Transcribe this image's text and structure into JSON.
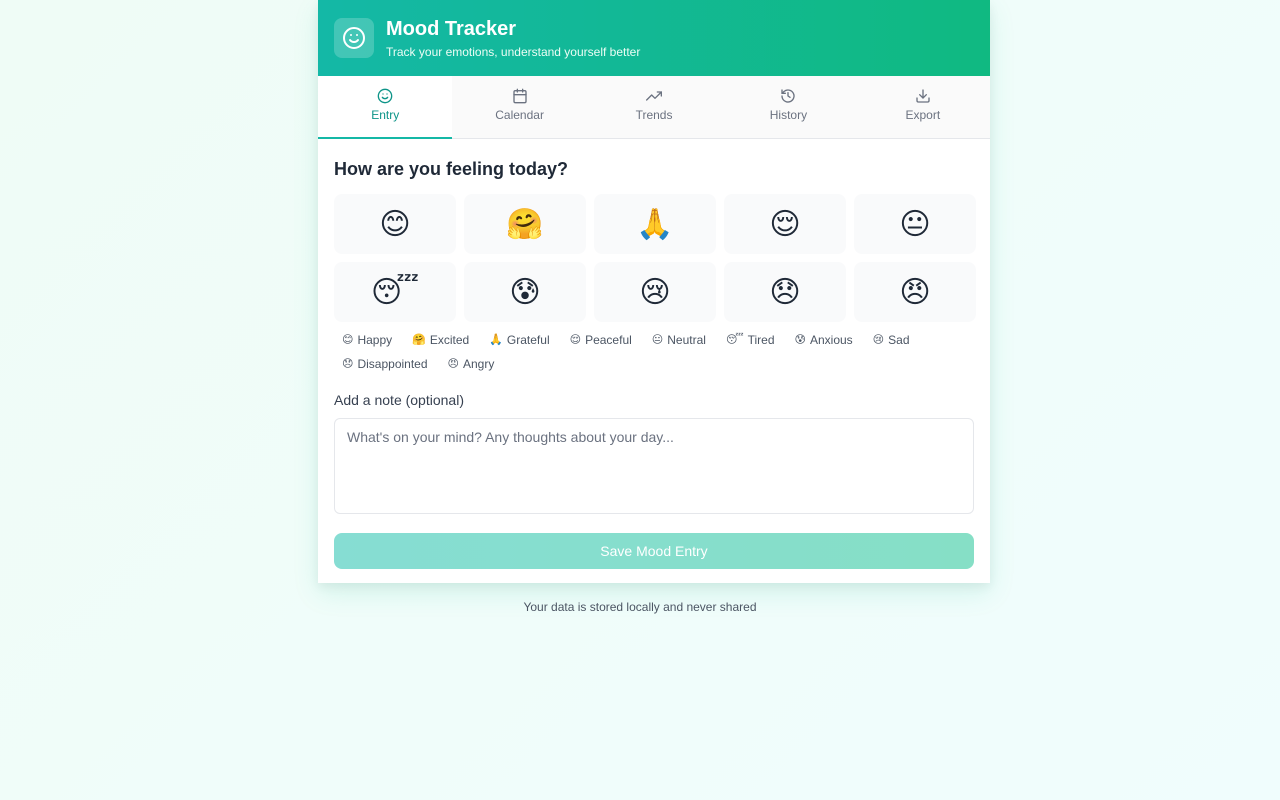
{
  "app": {
    "title": "Mood Tracker",
    "subtitle": "Track your emotions, understand yourself better",
    "logo_icon": "smile-icon"
  },
  "tabs": [
    {
      "label": "Entry",
      "icon": "smile-icon",
      "active": true
    },
    {
      "label": "Calendar",
      "icon": "calendar-icon",
      "active": false
    },
    {
      "label": "Trends",
      "icon": "trending-up-icon",
      "active": false
    },
    {
      "label": "History",
      "icon": "history-icon",
      "active": false
    },
    {
      "label": "Export",
      "icon": "download-icon",
      "active": false
    }
  ],
  "entry": {
    "question": "How are you feeling today?",
    "moods": [
      {
        "emoji": "😊",
        "label": "Happy"
      },
      {
        "emoji": "🤗",
        "label": "Excited"
      },
      {
        "emoji": "🙏",
        "label": "Grateful"
      },
      {
        "emoji": "😌",
        "label": "Peaceful"
      },
      {
        "emoji": "😐",
        "label": "Neutral"
      },
      {
        "emoji": "😴",
        "label": "Tired"
      },
      {
        "emoji": "😰",
        "label": "Anxious"
      },
      {
        "emoji": "😢",
        "label": "Sad"
      },
      {
        "emoji": "😞",
        "label": "Disappointed"
      },
      {
        "emoji": "😠",
        "label": "Angry"
      }
    ],
    "note_label": "Add a note (optional)",
    "note_placeholder": "What's on your mind? Any thoughts about your day...",
    "note_value": "",
    "save_label": "Save Mood Entry"
  },
  "footer": "Your data is stored locally and never shared",
  "colors": {
    "accent": "#14b8a6",
    "accent_dark": "#0d9488",
    "header_end": "#10b981"
  }
}
